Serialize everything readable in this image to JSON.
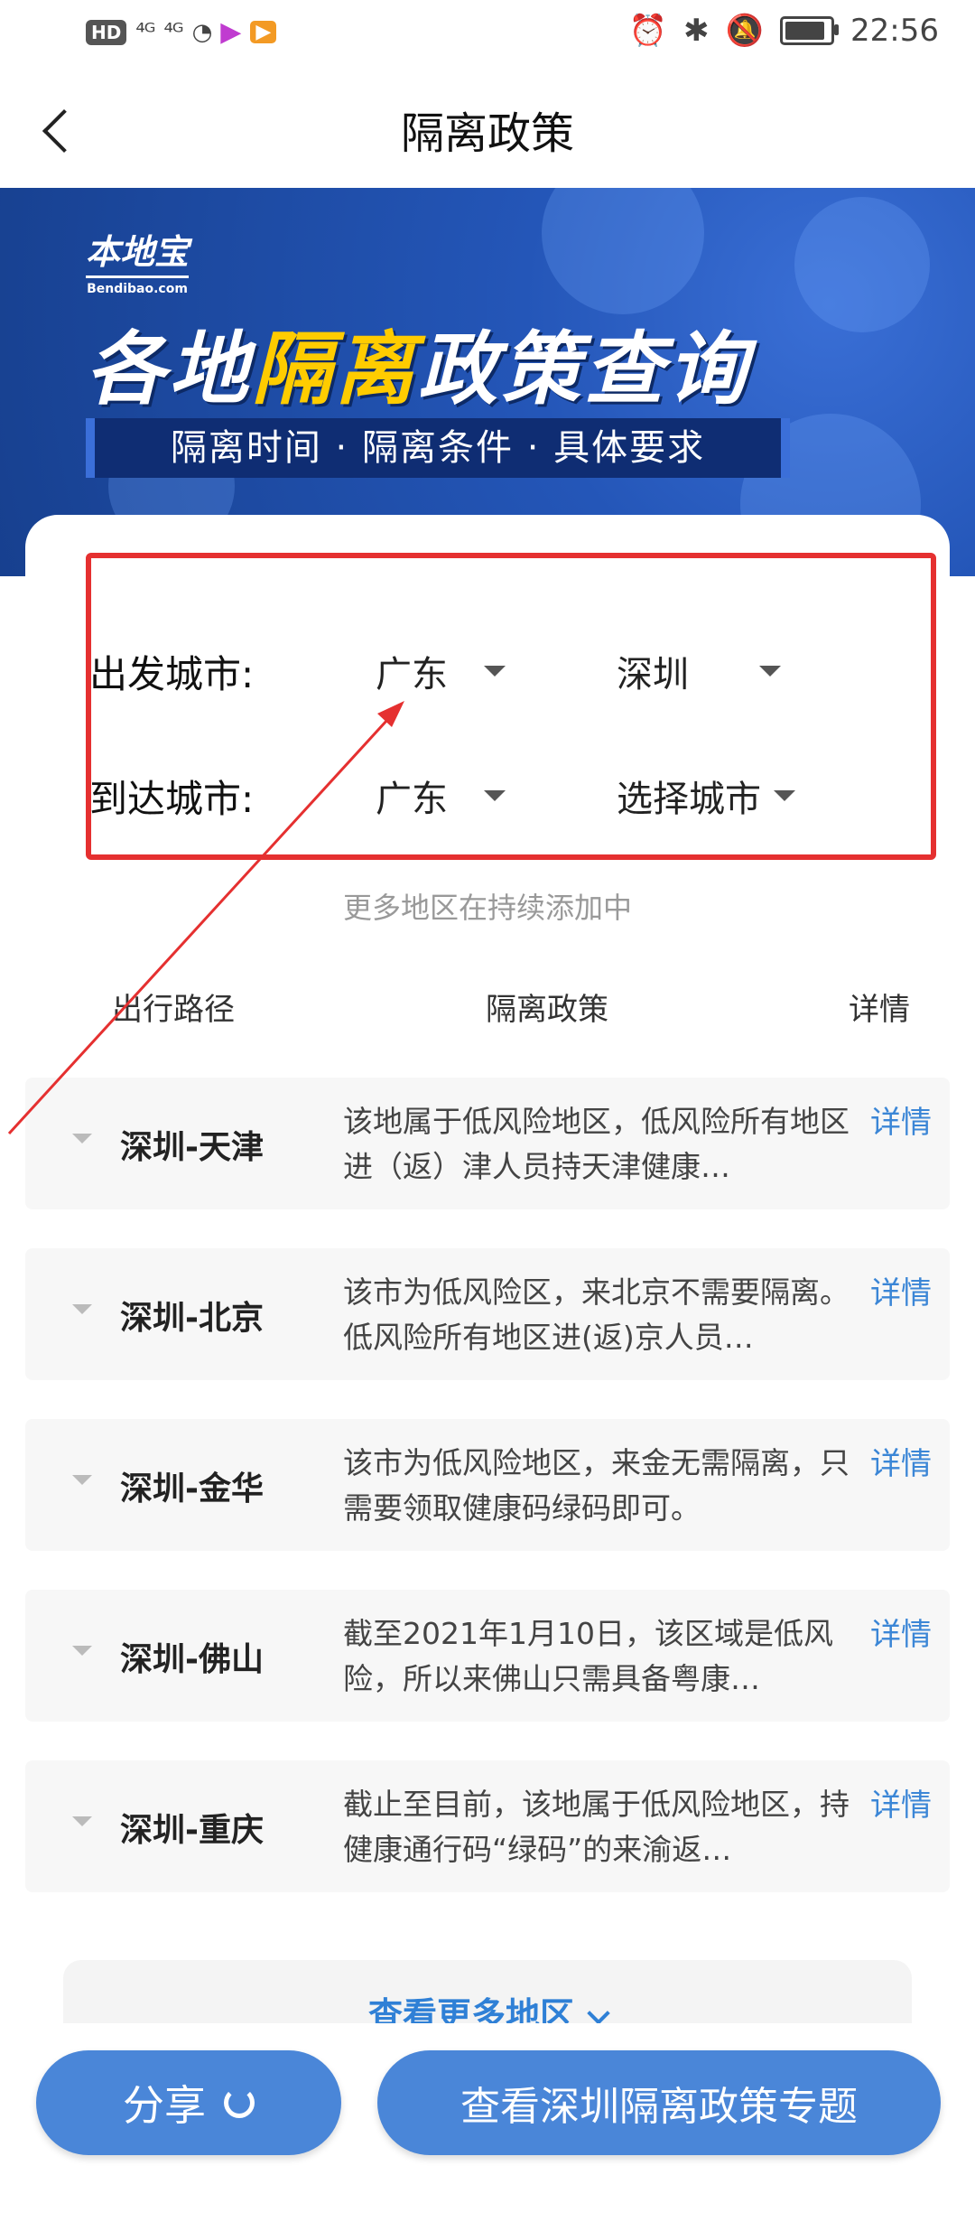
{
  "status_bar": {
    "hd": "HD",
    "signal_1": "⁴ᴳ",
    "signal_2": "⁴ᴳ",
    "time": "22:56"
  },
  "nav": {
    "title": "隔离政策"
  },
  "banner": {
    "logo": "本地宝",
    "logo_sub": "Bendibao.com",
    "title_pre": "各地",
    "title_highlight": "隔离",
    "title_post": "政策查询",
    "subtitle": "隔离时间 · 隔离条件 · 具体要求"
  },
  "selector": {
    "from_label": "出发城市:",
    "from_province": "广东",
    "from_city": "深圳",
    "to_label": "到达城市:",
    "to_province": "广东",
    "to_city": "选择城市"
  },
  "hint": "更多地区在持续添加中",
  "table": {
    "headers": [
      "出行路径",
      "隔离政策",
      "详情"
    ],
    "rows": [
      {
        "route": "深圳-天津",
        "policy": "该地属于低风险地区，低风险所有地区进（返）津人员持天津健康…",
        "detail": "详情"
      },
      {
        "route": "深圳-北京",
        "policy": "该市为低风险区，来北京不需要隔离。低风险所有地区进(返)京人员…",
        "detail": "详情"
      },
      {
        "route": "深圳-金华",
        "policy": "该市为低风险地区，来金无需隔离，只需要领取健康码绿码即可。",
        "detail": "详情"
      },
      {
        "route": "深圳-佛山",
        "policy": "截至2021年1月10日，该区域是低风险，所以来佛山只需具备粤康…",
        "detail": "详情"
      },
      {
        "route": "深圳-重庆",
        "policy": "截止至目前，该地属于低风险地区，持健康通行码“绿码”的来渝返…",
        "detail": "详情"
      }
    ]
  },
  "more": "查看更多地区",
  "bottom": {
    "share": "分享",
    "topic": "查看深圳隔离政策专题"
  },
  "colors": {
    "accent": "#4a86d8",
    "link": "#3b86d6",
    "annotation": "#e53030",
    "banner": "#2456b8",
    "highlight": "#ffcc00"
  }
}
